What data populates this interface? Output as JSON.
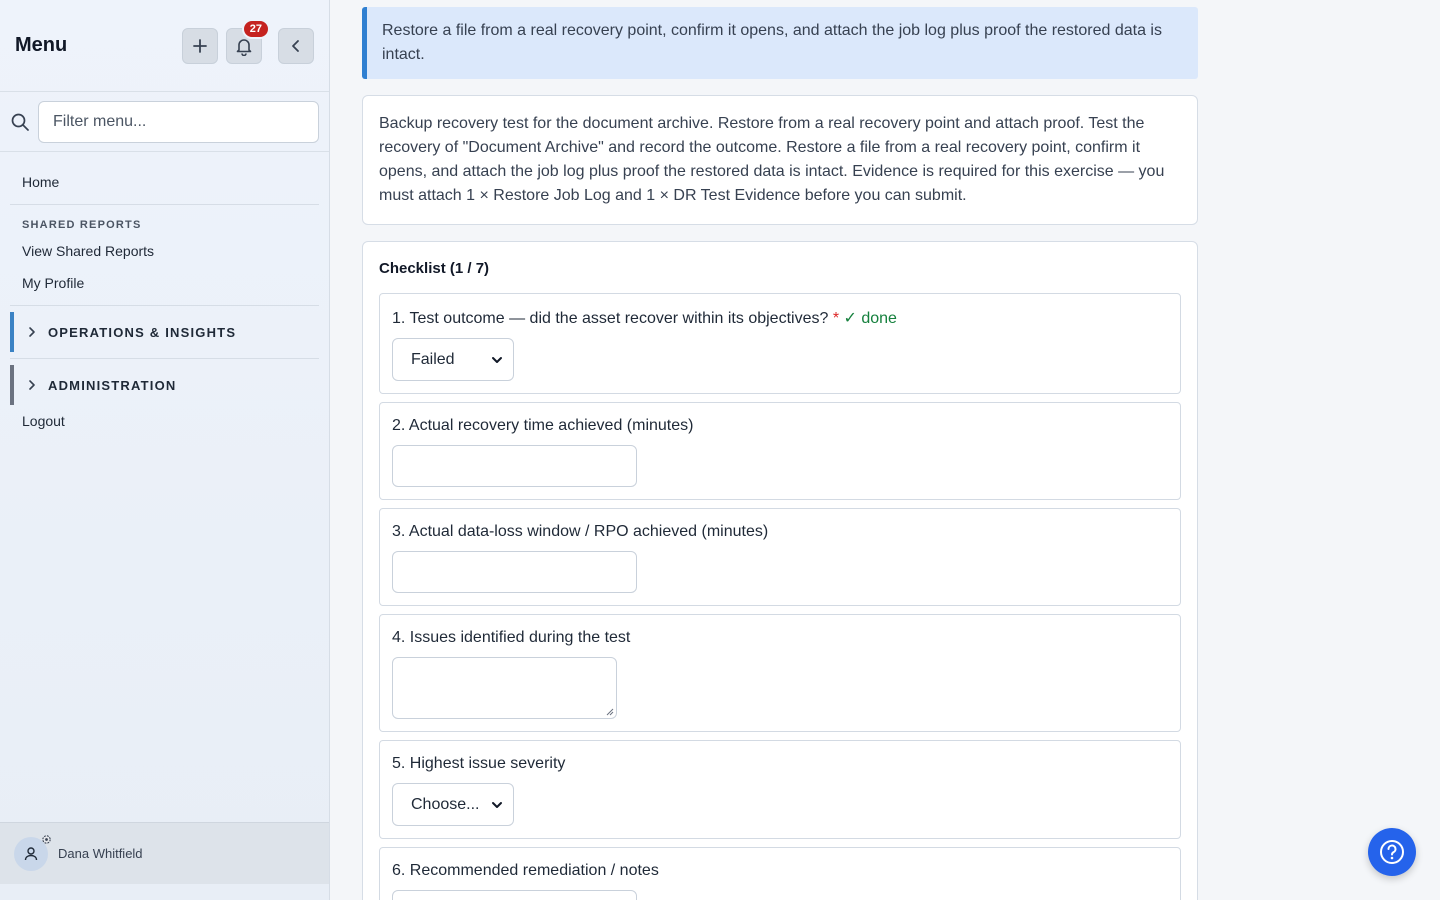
{
  "sidebar": {
    "title": "Menu",
    "notification_count": "27",
    "filter_placeholder": "Filter menu...",
    "home": "Home",
    "section_label": "SHARED REPORTS",
    "view_shared_reports": "View Shared Reports",
    "my_profile": "My Profile",
    "group_ops": "OPERATIONS & INSIGHTS",
    "group_admin": "ADMINISTRATION",
    "logout": "Logout",
    "user_name": "Dana Whitfield"
  },
  "main": {
    "callout": "Restore a file from a real recovery point, confirm it opens, and attach the job log plus proof the restored data is intact.",
    "description": "Backup recovery test for the document archive. Restore from a real recovery point and attach proof. Test the recovery of \"Document Archive\" and record the outcome. Restore a file from a real recovery point, confirm it opens, and attach the job log plus proof the restored data is intact. Evidence is required for this exercise — you must attach 1 × Restore Job Log and 1 × DR Test Evidence before you can submit.",
    "checklist_title": "Checklist (1 / 7)",
    "items": [
      {
        "label": "1. Test outcome — did the asset recover within its objectives?",
        "required": "*",
        "status": "✓ done",
        "value": "Failed"
      },
      {
        "label": "2. Actual recovery time achieved (minutes)"
      },
      {
        "label": "3. Actual data-loss window / RPO achieved (minutes)"
      },
      {
        "label": "4. Issues identified during the test"
      },
      {
        "label": "5. Highest issue severity",
        "value": "Choose..."
      },
      {
        "label": "6. Recommended remediation / notes"
      }
    ]
  },
  "colors": {
    "accent": "#2f7fd1",
    "badge": "#c5221f",
    "done": "#15803d",
    "required": "#dc2626",
    "help_button": "#2563eb"
  }
}
